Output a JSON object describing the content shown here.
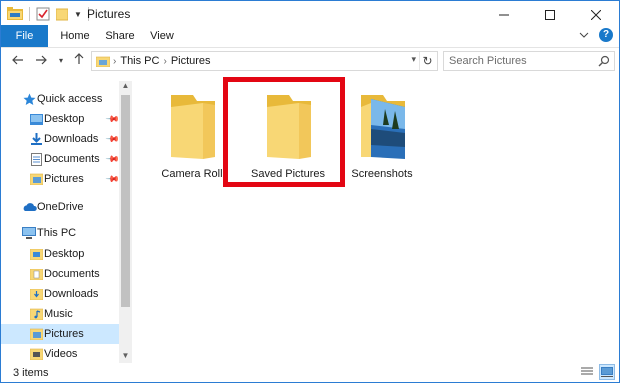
{
  "window": {
    "title": "Pictures"
  },
  "ribbon": {
    "tabs": [
      {
        "label": "File"
      },
      {
        "label": "Home"
      },
      {
        "label": "Share"
      },
      {
        "label": "View"
      }
    ]
  },
  "addressbar": {
    "crumbs": [
      "This PC",
      "Pictures"
    ],
    "search_placeholder": "Search Pictures"
  },
  "navpane": {
    "quick_access": {
      "label": "Quick access",
      "items": [
        {
          "label": "Desktop",
          "icon": "desktop-folder-icon",
          "pinned": true
        },
        {
          "label": "Downloads",
          "icon": "downloads-folder-icon",
          "pinned": true
        },
        {
          "label": "Documents",
          "icon": "documents-folder-icon",
          "pinned": true
        },
        {
          "label": "Pictures",
          "icon": "pictures-folder-icon",
          "pinned": true
        }
      ]
    },
    "onedrive": {
      "label": "OneDrive"
    },
    "this_pc": {
      "label": "This PC",
      "items": [
        {
          "label": "Desktop"
        },
        {
          "label": "Documents"
        },
        {
          "label": "Downloads"
        },
        {
          "label": "Music"
        },
        {
          "label": "Pictures",
          "selected": true
        },
        {
          "label": "Videos"
        }
      ]
    }
  },
  "content": {
    "items": [
      {
        "label": "Camera Roll",
        "type": "folder"
      },
      {
        "label": "Saved Pictures",
        "type": "folder",
        "highlighted": true
      },
      {
        "label": "Screenshots",
        "type": "folder-with-image"
      }
    ]
  },
  "statusbar": {
    "count_text": "3 items"
  },
  "colors": {
    "accent": "#1979ca",
    "selection": "#cce8ff",
    "highlight_border": "#e30613",
    "folder": "#f8d775"
  }
}
